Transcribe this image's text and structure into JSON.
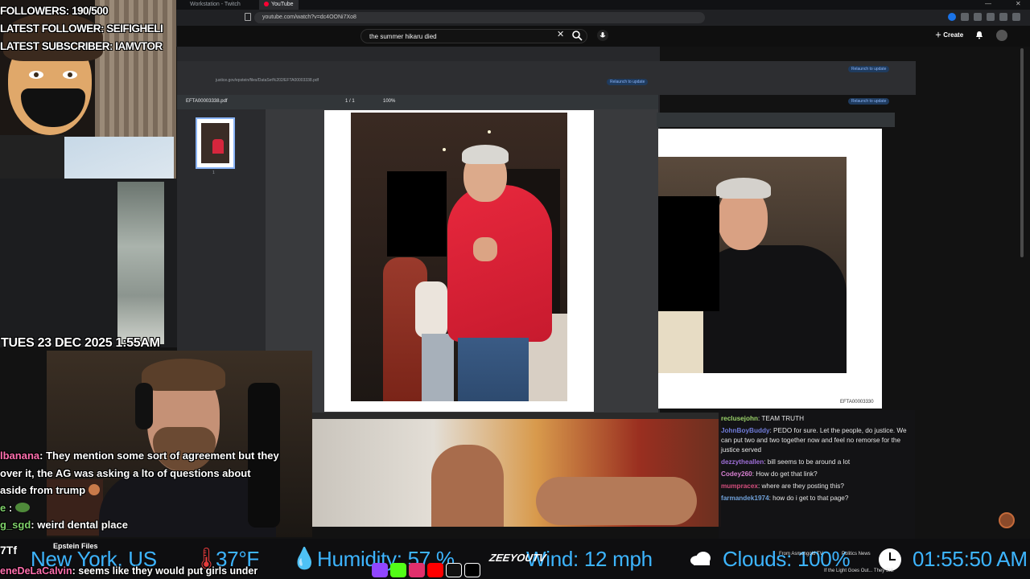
{
  "browser": {
    "tabs": [
      {
        "label": "Workstation - Twitch"
      },
      {
        "label": "YouTube"
      }
    ],
    "url": "youtube.com/watch?v=dc4OONi7Xo8"
  },
  "youtube": {
    "search_value": "the summer hikaru died",
    "create_label": "Create"
  },
  "pdf_viewer": {
    "url": "justice.gov/epstein/files/DataSet%202/EFTA00003338.pdf",
    "filename": "EFTA00003338.pdf",
    "page_indicator": "1 / 1",
    "zoom": "100%",
    "thumbnail_page": "1",
    "relaunch_label": "Relaunch to update"
  },
  "pdf_viewer_right": {
    "document_label": "EFTA00003330",
    "relaunch_label": "Relaunch to update"
  },
  "stream_overlay": {
    "followers": "FOLLOWERS: 190/500",
    "latest_follower": "LATEST FOLLOWER: SEIFIGHELI",
    "latest_subscriber": "LATEST SUBSCRIBER: IAMVTOR",
    "datetime": "TUES 23 DEC 2025 1:55AM"
  },
  "overlay_chat": [
    {
      "user": "lbanana",
      "message": ": They mention some sort of agreement but they"
    },
    {
      "user": "",
      "message": "over it, the AG was asking a lto of questions about"
    },
    {
      "user": "",
      "message": "aside from trump"
    },
    {
      "user": "e",
      "message": " :"
    },
    {
      "user": "g_sgd",
      "message": ": weird dental place"
    }
  ],
  "bottom_chat": {
    "user": "eneDeLaCalvin",
    "message": ": seems like they would put girls under"
  },
  "chat": [
    {
      "user": "reclusejohn",
      "color": "#9bd36a",
      "message": ": TEAM TRUTH"
    },
    {
      "user": "JohnBoyBuddy",
      "color": "#6f7bd8",
      "message": ": PEDO for sure. Let the people, do justice. We can put two and two together now and feel no remorse for the justice served"
    },
    {
      "user": "dezzytheallen",
      "color": "#9f6fd8",
      "message": ": bill seems to be around a lot"
    },
    {
      "user": "Codey260",
      "color": "#d77fd0",
      "message": ": How do get that link?"
    },
    {
      "user": "mumpracex",
      "color": "#d64e7e",
      "message": ": where are they posting this?"
    },
    {
      "user": "farmandek1974",
      "color": "#6fa0d8",
      "message": ": how do i get to that page?"
    }
  ],
  "ticker": {
    "location": "New York, US",
    "temperature": "37°F",
    "humidity": "Humidity: 57 %",
    "wind": "Wind: 12 mph",
    "clouds": "Clouds: 100%",
    "time": "01:55:50 AM",
    "left_label": "7Tf",
    "epstein_label": "Epstein Files",
    "news1": "From Asmongold TV",
    "news2": "Politics News",
    "news3": "If the Light Goes Out... They Still",
    "brand": "ZEEYOUTV"
  },
  "colors": {
    "ticker_blue": "#3db5ff",
    "hoodie_red": "#e8283d",
    "chat_accent": "#9bd36a"
  }
}
